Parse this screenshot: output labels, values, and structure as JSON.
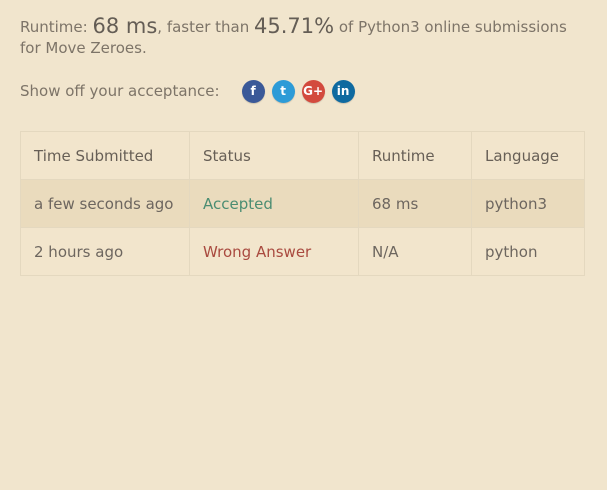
{
  "performance": {
    "runtime_label": "Runtime: ",
    "runtime_value": "68 ms",
    "faster_than_label": ", faster than ",
    "percentage": "45.71%",
    "suffix": " of Python3 online submissions for Move Zeroes."
  },
  "share": {
    "label": "Show off your acceptance:",
    "icons": [
      {
        "name": "facebook-icon",
        "glyph": "f",
        "color": "#3b5998"
      },
      {
        "name": "twitter-icon",
        "glyph": "t",
        "color": "#2d9bd7"
      },
      {
        "name": "google-plus-icon",
        "glyph": "G+",
        "color": "#d34a3e"
      },
      {
        "name": "linkedin-icon",
        "glyph": "in",
        "color": "#0f6aa0"
      }
    ]
  },
  "table": {
    "headers": [
      "Time Submitted",
      "Status",
      "Runtime",
      "Language"
    ],
    "rows": [
      {
        "time": "a few seconds ago",
        "status": "Accepted",
        "runtime": "68 ms",
        "language": "python3"
      },
      {
        "time": "2 hours ago",
        "status": "Wrong Answer",
        "runtime": "N/A",
        "language": "python"
      }
    ]
  },
  "colors": {
    "background": "#f1e5cd",
    "accepted": "#4b8d72",
    "wrong_answer": "#a94a3f"
  }
}
